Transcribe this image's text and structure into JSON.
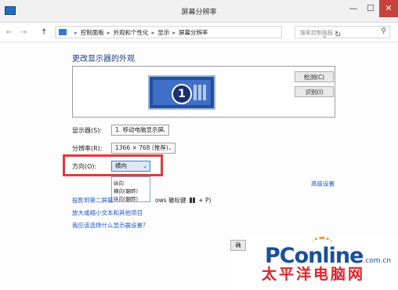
{
  "window": {
    "title": "屏幕分辨率",
    "min": "—",
    "max": "☐",
    "close": "✕"
  },
  "nav": {
    "back": "←",
    "forward": "→",
    "up": "↑",
    "breadcrumb": [
      "控制面板",
      "外观和个性化",
      "显示",
      "屏幕分辨率"
    ],
    "dropdown": "⌄",
    "refresh": "↻",
    "search_placeholder": "搜索控制面板"
  },
  "heading": "更改显示器的外观",
  "preview": {
    "monitor_number": "1",
    "detect_label": "检测(C)",
    "identify_label": "识别(I)"
  },
  "fields": {
    "display": {
      "label": "显示器(S):",
      "value": "1. 移动电脑显示屏"
    },
    "resolution": {
      "label": "分辨率(R):",
      "value": "1366 × 768 (推荐)"
    },
    "orientation": {
      "label": "方向(O):",
      "value": "横向",
      "options": [
        "纵向",
        "横向(翻转)",
        "纵向(翻转)"
      ]
    }
  },
  "advanced_link": "高级设置",
  "links": {
    "project": "投影到第二屏幕",
    "project_tail": "ows 徽标键",
    "project_keys": "+ P)",
    "text_size": "放大或缩小文本和其他项目",
    "which_settings": "我应该选择什么显示器设置?"
  },
  "bottom": {
    "cut_button": "确"
  },
  "watermark": {
    "brand": "PConline",
    "domain": ".com.cn",
    "cn": "太平洋电脑网"
  },
  "colors": {
    "accent": "#1e58c8",
    "highlight": "#e23a3a",
    "close": "#c7423a"
  }
}
